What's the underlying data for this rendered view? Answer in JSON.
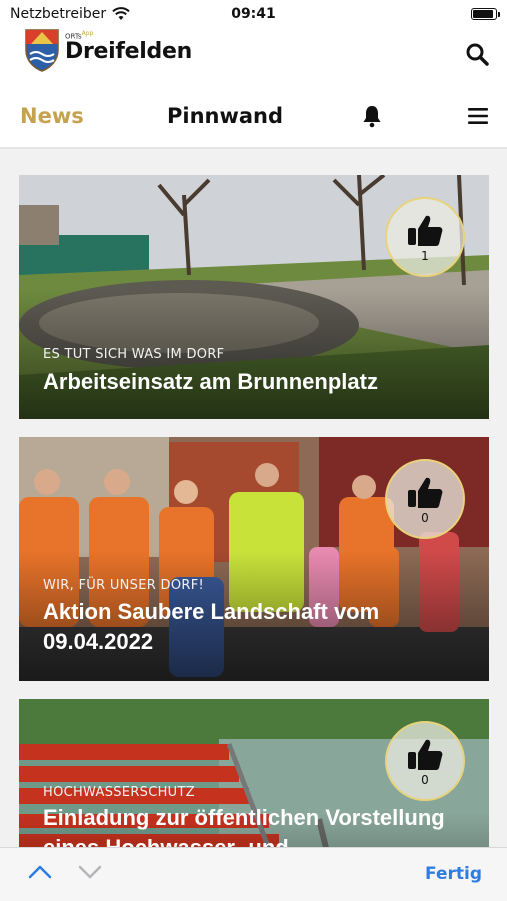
{
  "status_bar": {
    "carrier": "Netzbetreiber",
    "time": "09:41",
    "wifi_icon": "wifi-icon",
    "battery_icon": "battery-icon",
    "battery_level": 0.95
  },
  "header": {
    "app_label": "ORTs",
    "app_label_sup": "App",
    "app_name": "Dreifelden",
    "crest_icon": "crest-logo",
    "search_icon": "search-icon"
  },
  "nav": {
    "news": "News",
    "pinnwand": "Pinnwand",
    "bell_icon": "bell-icon",
    "menu_icon": "hamburger-menu-icon",
    "active_color": "#c4a24e"
  },
  "feed": [
    {
      "kicker": "ES TUT SICH WAS IM DORF",
      "title": "Arbeitseinsatz am Brunnenplatz",
      "likes": "1"
    },
    {
      "kicker": "WIR, FÜR UNSER DORF!",
      "title": "Aktion Saubere Landschaft vom 09.04.2022",
      "likes": "0"
    },
    {
      "kicker": "HOCHWASSERSCHUTZ",
      "title": "Einladung zur öffentlichen Vorstellung eines Hochwasser- und",
      "likes": "0"
    }
  ],
  "toolbar": {
    "up_icon": "chevron-up-icon",
    "down_icon": "chevron-down-icon",
    "done": "Fertig",
    "accent": "#2f7de1"
  }
}
